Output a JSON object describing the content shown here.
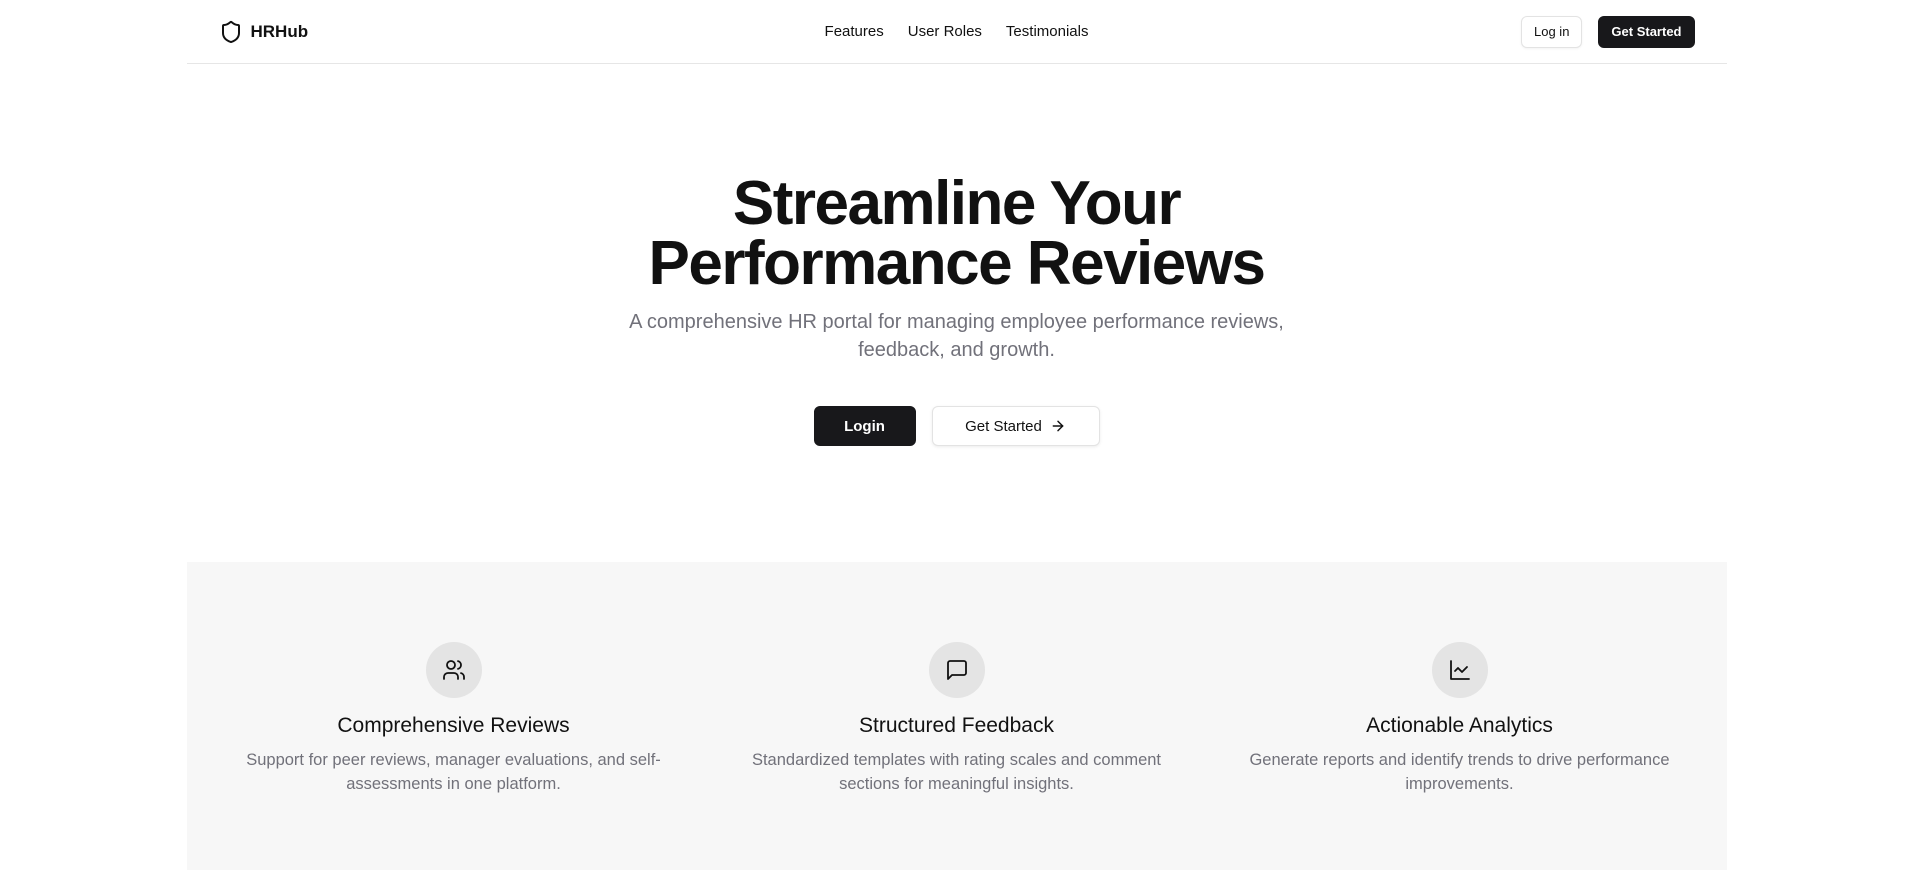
{
  "brand": {
    "name": "HRHub",
    "icon": "shield-icon"
  },
  "nav": {
    "items": [
      "Features",
      "User Roles",
      "Testimonials"
    ]
  },
  "header_actions": {
    "login_label": "Log in",
    "get_started_label": "Get Started"
  },
  "hero": {
    "title_line1": "Streamline Your",
    "title_line2": "Performance Reviews",
    "subtitle": "A comprehensive HR portal for managing employee performance reviews, feedback, and growth.",
    "login_label": "Login",
    "get_started_label": "Get Started",
    "get_started_icon": "arrow-right-icon"
  },
  "features": [
    {
      "icon": "users-icon",
      "title": "Comprehensive Reviews",
      "description": "Support for peer reviews, manager evaluations, and self-assessments in one platform."
    },
    {
      "icon": "message-square-icon",
      "title": "Structured Feedback",
      "description": "Standardized templates with rating scales and comment sections for meaningful insights."
    },
    {
      "icon": "line-chart-icon",
      "title": "Actionable Analytics",
      "description": "Generate reports and identify trends to drive performance improvements."
    }
  ],
  "colors": {
    "primary_dark": "#18181b",
    "muted_text": "#71717a",
    "section_bg": "#f7f7f7",
    "icon_circle_bg": "#e4e4e4"
  }
}
